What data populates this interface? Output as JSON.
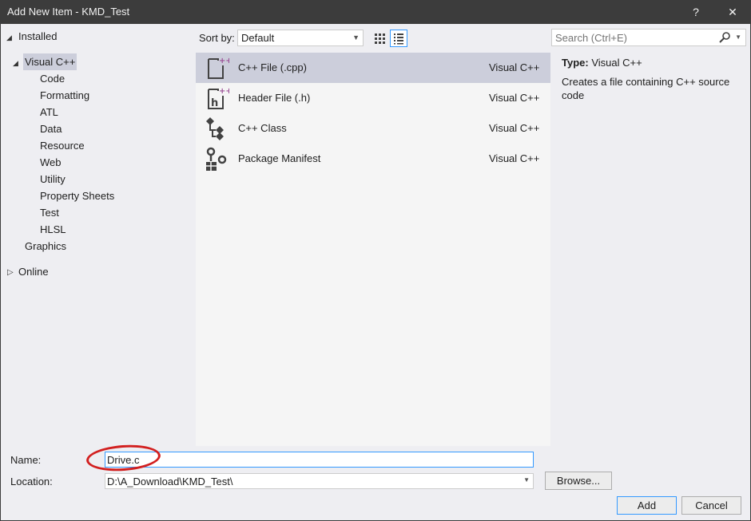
{
  "window": {
    "title": "Add New Item - KMD_Test",
    "help_glyph": "?",
    "close_glyph": "✕"
  },
  "tree": {
    "installed": "Installed",
    "visual_cpp": "Visual C++",
    "children": [
      "Code",
      "Formatting",
      "ATL",
      "Data",
      "Resource",
      "Web",
      "Utility",
      "Property Sheets",
      "Test",
      "HLSL"
    ],
    "graphics": "Graphics",
    "online": "Online"
  },
  "sort": {
    "label": "Sort by:",
    "value": "Default"
  },
  "search": {
    "placeholder": "Search (Ctrl+E)"
  },
  "templates": [
    {
      "name": "C++ File (.cpp)",
      "lang": "Visual C++",
      "icon": "cpp-file-icon"
    },
    {
      "name": "Header File (.h)",
      "lang": "Visual C++",
      "icon": "header-file-icon"
    },
    {
      "name": "C++ Class",
      "lang": "Visual C++",
      "icon": "cpp-class-icon"
    },
    {
      "name": "Package Manifest",
      "lang": "Visual C++",
      "icon": "package-manifest-icon"
    }
  ],
  "details": {
    "type_label": "Type:",
    "type_value": "Visual C++",
    "description": "Creates a file containing C++ source code"
  },
  "form": {
    "name_label": "Name:",
    "name_value": "Drive.c",
    "location_label": "Location:",
    "location_value": "D:\\A_Download\\KMD_Test\\",
    "browse_label": "Browse...",
    "add_label": "Add",
    "cancel_label": "Cancel"
  },
  "colors": {
    "titlebar": "#3c3c3c",
    "selection": "#cccedb",
    "accent": "#3399ff",
    "annotation": "#d21f1f",
    "plus_purple": "#9b4f96"
  }
}
